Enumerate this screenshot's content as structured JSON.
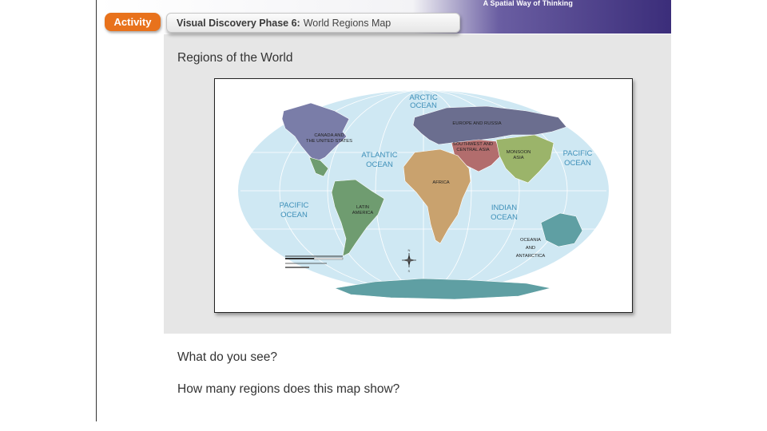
{
  "header": {
    "tagline": "A Spatial Way of Thinking",
    "activity_label": "Activity",
    "title_bold": "Visual Discovery Phase 6:",
    "title_rest": "World Regions Map"
  },
  "main": {
    "section_title": "Regions of the World"
  },
  "map": {
    "oceans": {
      "arctic_1": "ARCTIC",
      "arctic_2": "OCEAN",
      "atlantic_1": "ATLANTIC",
      "atlantic_2": "OCEAN",
      "pacific_east_1": "PACIFIC",
      "pacific_east_2": "OCEAN",
      "pacific_west_1": "PACIFIC",
      "pacific_west_2": "OCEAN",
      "indian_1": "INDIAN",
      "indian_2": "OCEAN"
    },
    "regions": {
      "canada_us_1": "CANADA AND",
      "canada_us_2": "THE UNITED STATES",
      "europe_russia": "EUROPE AND RUSSIA",
      "sw_central_asia_1": "SOUTHWEST AND",
      "sw_central_asia_2": "CENTRAL ASIA",
      "monsoon_asia_1": "MONSOON",
      "monsoon_asia_2": "ASIA",
      "africa": "AFRICA",
      "latin_america_1": "LATIN",
      "latin_america_2": "AMERICA",
      "oceania_1": "OCEANIA",
      "oceania_2": "AND",
      "oceania_3": "ANTARCTICA"
    },
    "compass": {
      "north": "N",
      "south": "S"
    },
    "colors": {
      "ocean": "#cfe8f3",
      "canada_us": "#7a7da8",
      "europe_russia": "#6b6e8f",
      "sw_central_asia": "#b26d6d",
      "monsoon_asia": "#9bb46a",
      "africa": "#c9a26e",
      "latin_america": "#6f9c70",
      "oceania_antarctica": "#5f9fa3"
    }
  },
  "questions": {
    "q1": "What do you see?",
    "q2": "How many regions does this map show?"
  }
}
